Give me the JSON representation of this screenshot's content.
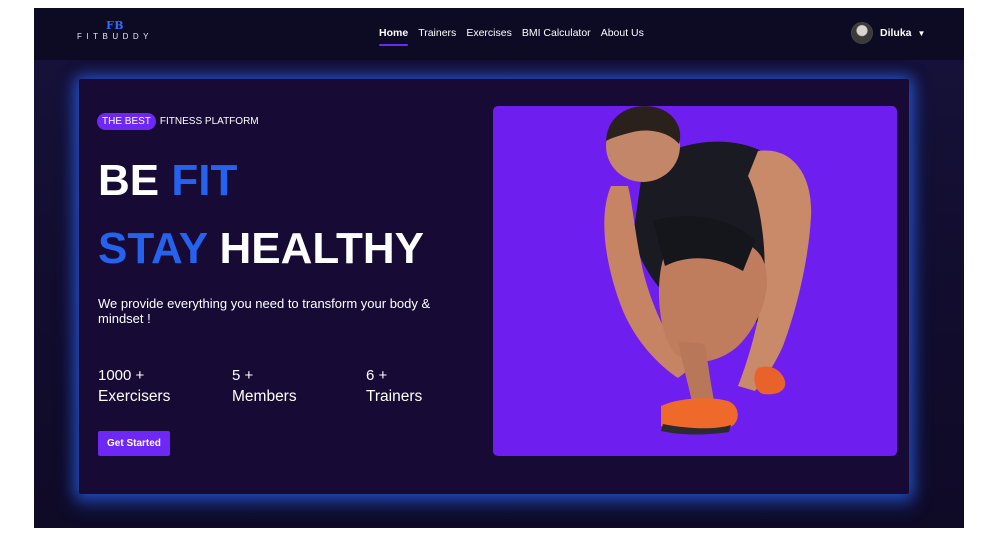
{
  "brand": {
    "mark": "FB",
    "name": "FITBUDDY"
  },
  "nav": {
    "links": [
      "Home",
      "Trainers",
      "Exercises",
      "BMI Calculator",
      "About Us"
    ],
    "active": "Home"
  },
  "user": {
    "name": "Diluka",
    "avatar_icon": "user-avatar",
    "caret_icon": "caret-down-icon"
  },
  "hero": {
    "badge": "THE BEST",
    "tagline_rest": "FITNESS PLATFORM",
    "line1": {
      "white": "BE ",
      "blue": "FIT"
    },
    "line2": {
      "blue": "STAY ",
      "white": "HEALTHY"
    },
    "description": "We provide everything you need to transform your body & mindset !",
    "stats": [
      {
        "value": "1000 +",
        "label": "Exercisers"
      },
      {
        "value": "5 +",
        "label": "Members"
      },
      {
        "value": "6 +",
        "label": "Trainers"
      }
    ],
    "cta": "Get Started",
    "image_alt": "athlete tying shoe"
  },
  "colors": {
    "accent": "#6d28f5",
    "blue": "#2563ee",
    "background": "#170b36",
    "navbar": "#0d0a24",
    "glow": "#2d6eff"
  }
}
